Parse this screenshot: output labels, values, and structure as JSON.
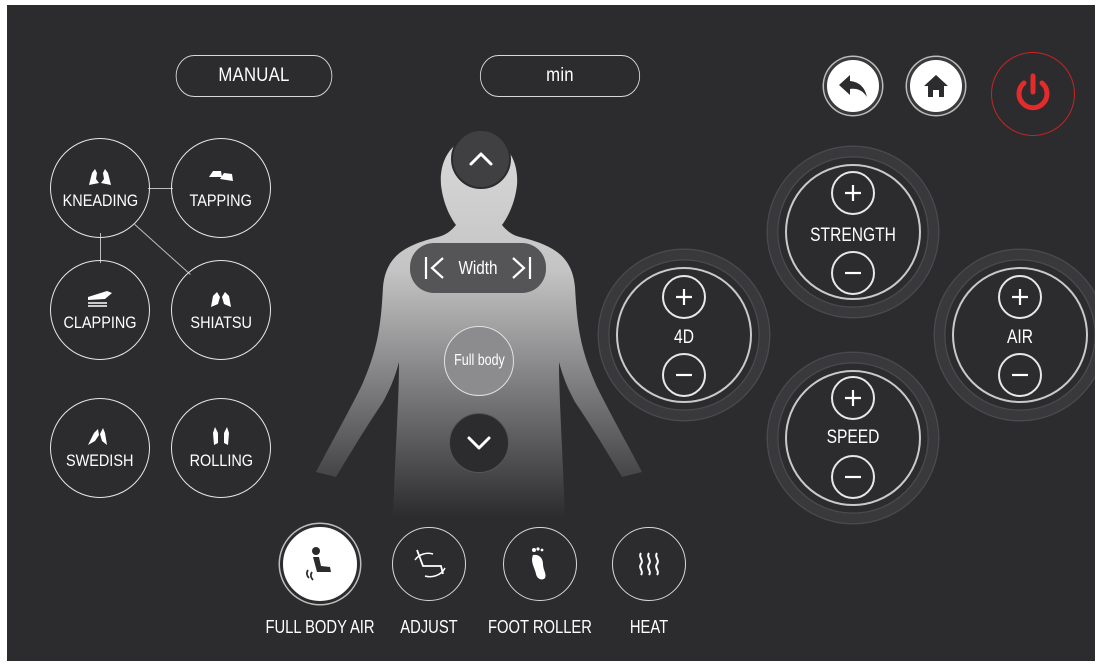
{
  "header": {
    "mode_label": "MANUAL",
    "timer_label": "min"
  },
  "top_buttons": {
    "back": "back-icon",
    "home": "home-icon",
    "power": "power-icon"
  },
  "massage_modes": [
    {
      "label": "KNEADING",
      "icon": "kneading-hands-icon"
    },
    {
      "label": "TAPPING",
      "icon": "tapping-hands-icon"
    },
    {
      "label": "CLAPPING",
      "icon": "clapping-hand-icon"
    },
    {
      "label": "SHIATSU",
      "icon": "shiatsu-thumbs-icon"
    },
    {
      "label": "SWEDISH",
      "icon": "swedish-hands-icon"
    },
    {
      "label": "ROLLING",
      "icon": "rolling-hands-icon"
    }
  ],
  "body_panel": {
    "width_label": "Width",
    "full_body_label": "Full body",
    "up_icon": "chevron-up-icon",
    "down_icon": "chevron-down-icon"
  },
  "controls": [
    {
      "label": "STRENGTH"
    },
    {
      "label": "4D"
    },
    {
      "label": "AIR"
    },
    {
      "label": "SPEED"
    }
  ],
  "bottom_functions": [
    {
      "label": "FULL BODY AIR",
      "icon": "person-seated-icon"
    },
    {
      "label": "ADJUST",
      "icon": "recline-icon"
    },
    {
      "label": "FOOT ROLLER",
      "icon": "foot-icon"
    },
    {
      "label": "HEAT",
      "icon": "heat-waves-icon"
    }
  ],
  "colors": {
    "background": "#2c2c2e",
    "accent_red": "#e32b2b",
    "button_white": "#ffffff"
  }
}
